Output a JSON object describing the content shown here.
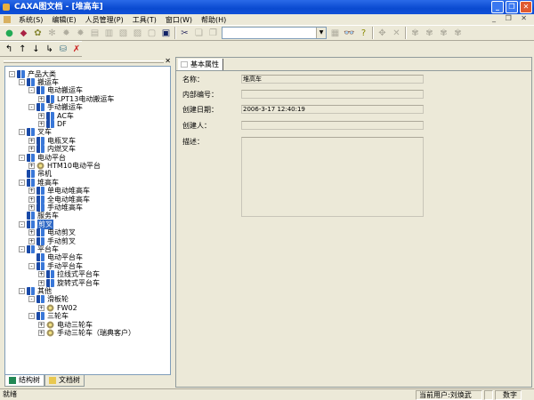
{
  "window": {
    "title": "CAXA图文档 - [堆高车]"
  },
  "menu": [
    "系统(S)",
    "编辑(E)",
    "人员管理(P)",
    "工具(T)",
    "窗口(W)",
    "帮助(H)"
  ],
  "search": {
    "value": ""
  },
  "tree": [
    {
      "label": "产品大类",
      "level": 0,
      "exp": "-",
      "icon": "book"
    },
    {
      "label": "搬运车",
      "level": 1,
      "exp": "-",
      "icon": "book"
    },
    {
      "label": "电动搬运车",
      "level": 2,
      "exp": "-",
      "icon": "book"
    },
    {
      "label": "LPT13电动搬运车",
      "level": 3,
      "exp": "+",
      "icon": "book"
    },
    {
      "label": "手动搬运车",
      "level": 2,
      "exp": "-",
      "icon": "book"
    },
    {
      "label": "AC车",
      "level": 3,
      "exp": "+",
      "icon": "book"
    },
    {
      "label": "DF",
      "level": 3,
      "exp": "+",
      "icon": "book"
    },
    {
      "label": "叉车",
      "level": 1,
      "exp": "-",
      "icon": "book"
    },
    {
      "label": "电瓶叉车",
      "level": 2,
      "exp": "+",
      "icon": "book"
    },
    {
      "label": "内燃叉车",
      "level": 2,
      "exp": "+",
      "icon": "book"
    },
    {
      "label": "电动平台",
      "level": 1,
      "exp": "-",
      "icon": "book"
    },
    {
      "label": "HTM10电动平台",
      "level": 2,
      "exp": "+",
      "icon": "gear"
    },
    {
      "label": "吊机",
      "level": 1,
      "exp": "",
      "icon": "book"
    },
    {
      "label": "堆高车",
      "level": 1,
      "exp": "-",
      "icon": "book"
    },
    {
      "label": "单电动堆高车",
      "level": 2,
      "exp": "+",
      "icon": "book"
    },
    {
      "label": "全电动堆高车",
      "level": 2,
      "exp": "+",
      "icon": "book"
    },
    {
      "label": "手动堆高车",
      "level": 2,
      "exp": "+",
      "icon": "book"
    },
    {
      "label": "服务车",
      "level": 1,
      "exp": "",
      "icon": "book"
    },
    {
      "label": "剪叉",
      "level": 1,
      "exp": "-",
      "icon": "book",
      "selected": true
    },
    {
      "label": "电动剪叉",
      "level": 2,
      "exp": "+",
      "icon": "book"
    },
    {
      "label": "手动剪叉",
      "level": 2,
      "exp": "+",
      "icon": "book"
    },
    {
      "label": "平台车",
      "level": 1,
      "exp": "-",
      "icon": "book"
    },
    {
      "label": "电动平台车",
      "level": 2,
      "exp": "",
      "icon": "book"
    },
    {
      "label": "手动平台车",
      "level": 2,
      "exp": "-",
      "icon": "book"
    },
    {
      "label": "拉线式平台车",
      "level": 3,
      "exp": "+",
      "icon": "book"
    },
    {
      "label": "旋转式平台车",
      "level": 3,
      "exp": "+",
      "icon": "book"
    },
    {
      "label": "其他",
      "level": 1,
      "exp": "-",
      "icon": "book"
    },
    {
      "label": "滑板轮",
      "level": 2,
      "exp": "-",
      "icon": "book"
    },
    {
      "label": "FW02",
      "level": 3,
      "exp": "+",
      "icon": "gear"
    },
    {
      "label": "三轮车",
      "level": 2,
      "exp": "-",
      "icon": "book"
    },
    {
      "label": "电动三轮车",
      "level": 3,
      "exp": "+",
      "icon": "gear"
    },
    {
      "label": "手动三轮车（瑞典客户）",
      "level": 3,
      "exp": "+",
      "icon": "gear"
    }
  ],
  "left_tabs": [
    "结构树",
    "文档树"
  ],
  "props": {
    "tab": "基本属性",
    "name_label": "名称：",
    "name_value": "堆高车",
    "code_label": "内部编号：",
    "code_value": "",
    "date_label": "创建日期：",
    "date_value": "2006-3-17 12:40:19",
    "creator_label": "创建人：",
    "creator_value": "",
    "desc_label": "描述：",
    "desc_value": ""
  },
  "status": {
    "ready": "就绪",
    "user": "当前用户:刘焕武",
    "mode": "数字"
  }
}
